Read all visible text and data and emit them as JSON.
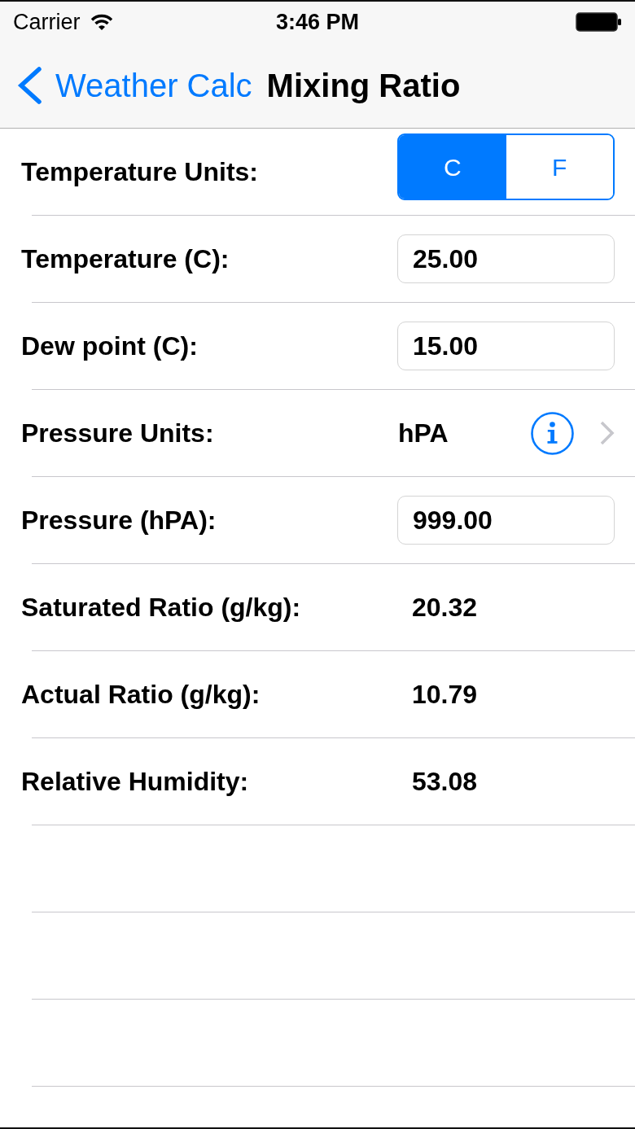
{
  "status_bar": {
    "carrier": "Carrier",
    "time": "3:46 PM"
  },
  "nav": {
    "back_label": "Weather Calc",
    "title": "Mixing Ratio"
  },
  "rows": [
    {
      "kind": "segmented",
      "label": "Temperature Units:",
      "segments": [
        {
          "label": "C",
          "selected": true
        },
        {
          "label": "F",
          "selected": false
        }
      ]
    },
    {
      "kind": "input",
      "label": "Temperature (C):",
      "value": "25.00"
    },
    {
      "kind": "input",
      "label": "Dew point (C):",
      "value": "15.00"
    },
    {
      "kind": "picker",
      "label": "Pressure Units:",
      "value": "hPA"
    },
    {
      "kind": "input",
      "label": "Pressure (hPA):",
      "value": "999.00"
    },
    {
      "kind": "output",
      "label": "Saturated Ratio (g/kg):",
      "value": "20.32"
    },
    {
      "kind": "output",
      "label": "Actual Ratio (g/kg):",
      "value": "10.79"
    },
    {
      "kind": "output",
      "label": "Relative Humidity:",
      "value": "53.08"
    }
  ]
}
